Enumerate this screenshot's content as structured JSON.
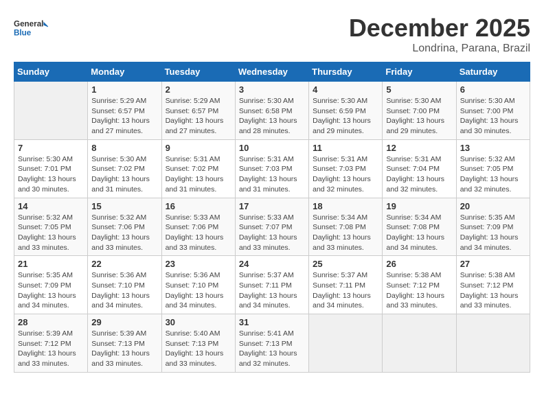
{
  "header": {
    "logo_line1": "General",
    "logo_line2": "Blue",
    "month": "December 2025",
    "location": "Londrina, Parana, Brazil"
  },
  "days_of_week": [
    "Sunday",
    "Monday",
    "Tuesday",
    "Wednesday",
    "Thursday",
    "Friday",
    "Saturday"
  ],
  "weeks": [
    [
      {
        "day": "",
        "info": ""
      },
      {
        "day": "1",
        "info": "Sunrise: 5:29 AM\nSunset: 6:57 PM\nDaylight: 13 hours\nand 27 minutes."
      },
      {
        "day": "2",
        "info": "Sunrise: 5:29 AM\nSunset: 6:57 PM\nDaylight: 13 hours\nand 27 minutes."
      },
      {
        "day": "3",
        "info": "Sunrise: 5:30 AM\nSunset: 6:58 PM\nDaylight: 13 hours\nand 28 minutes."
      },
      {
        "day": "4",
        "info": "Sunrise: 5:30 AM\nSunset: 6:59 PM\nDaylight: 13 hours\nand 29 minutes."
      },
      {
        "day": "5",
        "info": "Sunrise: 5:30 AM\nSunset: 7:00 PM\nDaylight: 13 hours\nand 29 minutes."
      },
      {
        "day": "6",
        "info": "Sunrise: 5:30 AM\nSunset: 7:00 PM\nDaylight: 13 hours\nand 30 minutes."
      }
    ],
    [
      {
        "day": "7",
        "info": "Sunrise: 5:30 AM\nSunset: 7:01 PM\nDaylight: 13 hours\nand 30 minutes."
      },
      {
        "day": "8",
        "info": "Sunrise: 5:30 AM\nSunset: 7:02 PM\nDaylight: 13 hours\nand 31 minutes."
      },
      {
        "day": "9",
        "info": "Sunrise: 5:31 AM\nSunset: 7:02 PM\nDaylight: 13 hours\nand 31 minutes."
      },
      {
        "day": "10",
        "info": "Sunrise: 5:31 AM\nSunset: 7:03 PM\nDaylight: 13 hours\nand 31 minutes."
      },
      {
        "day": "11",
        "info": "Sunrise: 5:31 AM\nSunset: 7:03 PM\nDaylight: 13 hours\nand 32 minutes."
      },
      {
        "day": "12",
        "info": "Sunrise: 5:31 AM\nSunset: 7:04 PM\nDaylight: 13 hours\nand 32 minutes."
      },
      {
        "day": "13",
        "info": "Sunrise: 5:32 AM\nSunset: 7:05 PM\nDaylight: 13 hours\nand 32 minutes."
      }
    ],
    [
      {
        "day": "14",
        "info": "Sunrise: 5:32 AM\nSunset: 7:05 PM\nDaylight: 13 hours\nand 33 minutes."
      },
      {
        "day": "15",
        "info": "Sunrise: 5:32 AM\nSunset: 7:06 PM\nDaylight: 13 hours\nand 33 minutes."
      },
      {
        "day": "16",
        "info": "Sunrise: 5:33 AM\nSunset: 7:06 PM\nDaylight: 13 hours\nand 33 minutes."
      },
      {
        "day": "17",
        "info": "Sunrise: 5:33 AM\nSunset: 7:07 PM\nDaylight: 13 hours\nand 33 minutes."
      },
      {
        "day": "18",
        "info": "Sunrise: 5:34 AM\nSunset: 7:08 PM\nDaylight: 13 hours\nand 33 minutes."
      },
      {
        "day": "19",
        "info": "Sunrise: 5:34 AM\nSunset: 7:08 PM\nDaylight: 13 hours\nand 34 minutes."
      },
      {
        "day": "20",
        "info": "Sunrise: 5:35 AM\nSunset: 7:09 PM\nDaylight: 13 hours\nand 34 minutes."
      }
    ],
    [
      {
        "day": "21",
        "info": "Sunrise: 5:35 AM\nSunset: 7:09 PM\nDaylight: 13 hours\nand 34 minutes."
      },
      {
        "day": "22",
        "info": "Sunrise: 5:36 AM\nSunset: 7:10 PM\nDaylight: 13 hours\nand 34 minutes."
      },
      {
        "day": "23",
        "info": "Sunrise: 5:36 AM\nSunset: 7:10 PM\nDaylight: 13 hours\nand 34 minutes."
      },
      {
        "day": "24",
        "info": "Sunrise: 5:37 AM\nSunset: 7:11 PM\nDaylight: 13 hours\nand 34 minutes."
      },
      {
        "day": "25",
        "info": "Sunrise: 5:37 AM\nSunset: 7:11 PM\nDaylight: 13 hours\nand 34 minutes."
      },
      {
        "day": "26",
        "info": "Sunrise: 5:38 AM\nSunset: 7:12 PM\nDaylight: 13 hours\nand 33 minutes."
      },
      {
        "day": "27",
        "info": "Sunrise: 5:38 AM\nSunset: 7:12 PM\nDaylight: 13 hours\nand 33 minutes."
      }
    ],
    [
      {
        "day": "28",
        "info": "Sunrise: 5:39 AM\nSunset: 7:12 PM\nDaylight: 13 hours\nand 33 minutes."
      },
      {
        "day": "29",
        "info": "Sunrise: 5:39 AM\nSunset: 7:13 PM\nDaylight: 13 hours\nand 33 minutes."
      },
      {
        "day": "30",
        "info": "Sunrise: 5:40 AM\nSunset: 7:13 PM\nDaylight: 13 hours\nand 33 minutes."
      },
      {
        "day": "31",
        "info": "Sunrise: 5:41 AM\nSunset: 7:13 PM\nDaylight: 13 hours\nand 32 minutes."
      },
      {
        "day": "",
        "info": ""
      },
      {
        "day": "",
        "info": ""
      },
      {
        "day": "",
        "info": ""
      }
    ]
  ]
}
